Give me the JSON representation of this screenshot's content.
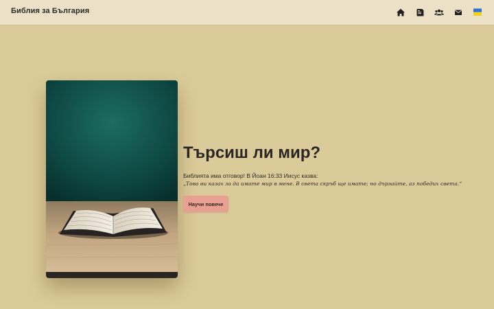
{
  "header": {
    "brand": "Библия за България",
    "nav": [
      {
        "icon": "home-icon"
      },
      {
        "icon": "book-icon"
      },
      {
        "icon": "group-icon"
      },
      {
        "icon": "mail-icon"
      },
      {
        "icon": "ukraine-flag-icon",
        "colors": [
          "#2f6fd6",
          "#f5d21a"
        ]
      }
    ]
  },
  "hero": {
    "image": "open-bible-on-table",
    "title": "Търсиш ли мир?",
    "intro": "Библията има отговор! В Йоан 16:33 Иисус казва:",
    "quote": "„Това ви казах за да имате мир в мене. В света скръб ще имате; но дързайте, аз победих света.“",
    "cta_label": "Научи повече"
  },
  "colors": {
    "background": "#dccb9a",
    "header": "#ece1c7",
    "cta": "#e8a092",
    "text": "#2a2a2a"
  }
}
